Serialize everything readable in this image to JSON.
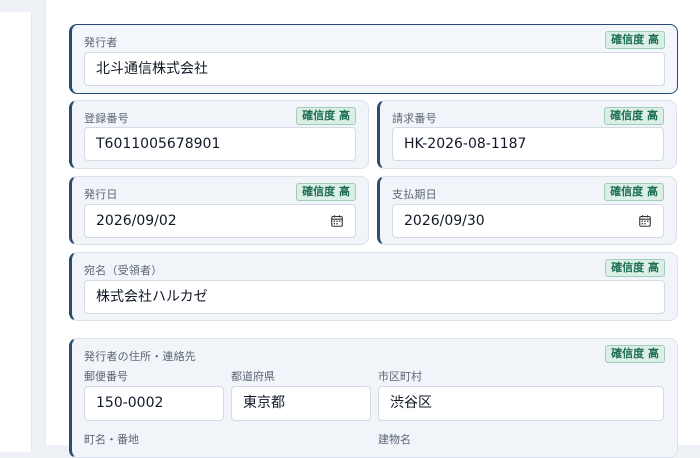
{
  "confidence_badge": "確信度 高",
  "fields": {
    "issuer": {
      "label": "発行者",
      "value": "北斗通信株式会社"
    },
    "registration_number": {
      "label": "登録番号",
      "value": "T6011005678901"
    },
    "invoice_number": {
      "label": "請求番号",
      "value": "HK-2026-08-1187"
    },
    "issue_date": {
      "label": "発行日",
      "value": "2026/09/02"
    },
    "due_date": {
      "label": "支払期日",
      "value": "2026/09/30"
    },
    "recipient": {
      "label": "宛名（受領者）",
      "value": "株式会社ハルカゼ"
    }
  },
  "address": {
    "label": "発行者の住所・連絡先",
    "postal_code": {
      "label": "郵便番号",
      "value": "150-0002"
    },
    "prefecture": {
      "label": "都道府県",
      "value": "東京都"
    },
    "city": {
      "label": "市区町村",
      "value": "渋谷区"
    },
    "street": {
      "label": "町名・番地"
    },
    "building": {
      "label": "建物名"
    }
  },
  "icons": {
    "calendar": "calendar-icon"
  },
  "colors": {
    "accent": "#2f4b6e",
    "badge_text": "#1f6f54",
    "badge_bg": "#dcefe6"
  }
}
